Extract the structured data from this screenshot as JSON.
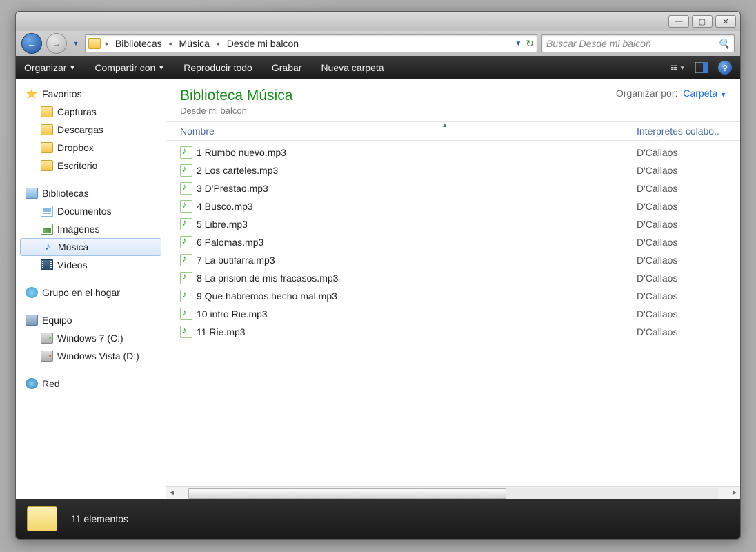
{
  "breadcrumb": {
    "items": [
      "Bibliotecas",
      "Música",
      "Desde mi balcon"
    ]
  },
  "search": {
    "placeholder": "Buscar Desde mi balcon"
  },
  "toolbar": {
    "organize": "Organizar",
    "share": "Compartir con",
    "play_all": "Reproducir todo",
    "burn": "Grabar",
    "new_folder": "Nueva carpeta"
  },
  "sidebar": {
    "favorites": {
      "label": "Favoritos",
      "items": [
        "Capturas",
        "Descargas",
        "Dropbox",
        "Escritorio"
      ]
    },
    "libraries": {
      "label": "Bibliotecas",
      "items": [
        "Documentos",
        "Imágenes",
        "Música",
        "Vídeos"
      ],
      "selected": 2
    },
    "homegroup": {
      "label": "Grupo en el hogar"
    },
    "computer": {
      "label": "Equipo",
      "items": [
        "Windows 7 (C:)",
        "Windows Vista (D:)"
      ]
    },
    "network": {
      "label": "Red"
    }
  },
  "library": {
    "title": "Biblioteca Música",
    "subtitle": "Desde mi balcon",
    "organize_label": "Organizar por:",
    "organize_value": "Carpeta"
  },
  "columns": {
    "name": "Nombre",
    "artists": "Intérpretes colabo.."
  },
  "files": [
    {
      "name": "1 Rumbo nuevo.mp3",
      "artist": "D'Callaos"
    },
    {
      "name": "2 Los carteles.mp3",
      "artist": "D'Callaos"
    },
    {
      "name": "3 D'Prestao.mp3",
      "artist": "D'Callaos"
    },
    {
      "name": "4 Busco.mp3",
      "artist": "D'Callaos"
    },
    {
      "name": "5 Libre.mp3",
      "artist": "D'Callaos"
    },
    {
      "name": "6 Palomas.mp3",
      "artist": "D'Callaos"
    },
    {
      "name": "7 La butifarra.mp3",
      "artist": "D'Callaos"
    },
    {
      "name": "8 La prision de mis fracasos.mp3",
      "artist": "D'Callaos"
    },
    {
      "name": "9 Que habremos hecho mal.mp3",
      "artist": "D'Callaos"
    },
    {
      "name": "10 intro Rie.mp3",
      "artist": "D'Callaos"
    },
    {
      "name": "11 Rie.mp3",
      "artist": "D'Callaos"
    }
  ],
  "status": {
    "count": "11 elementos"
  }
}
